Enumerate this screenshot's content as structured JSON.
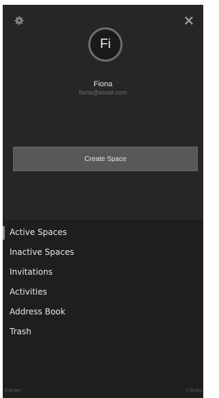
{
  "header": {
    "settings_icon": "gear-icon",
    "close_icon": "close-icon",
    "avatar_initials": "Fi",
    "user_name": "Fiona",
    "user_email": "fiona@email.com"
  },
  "create_space_label": "Create Space",
  "nav": {
    "items": [
      {
        "label": "Active Spaces",
        "active": true
      },
      {
        "label": "Inactive Spaces"
      },
      {
        "label": "Invitations"
      },
      {
        "label": "Activities"
      },
      {
        "label": "Address Book"
      },
      {
        "label": "Trash"
      }
    ]
  },
  "footer": {
    "left_storage": "0 Bytes",
    "right_storage": "0 Bytes"
  },
  "colors": {
    "panel_bg": "#1e1e1e",
    "header_bg": "#262626",
    "button_bg": "#585858",
    "active_indicator": "#8a8a8a"
  }
}
